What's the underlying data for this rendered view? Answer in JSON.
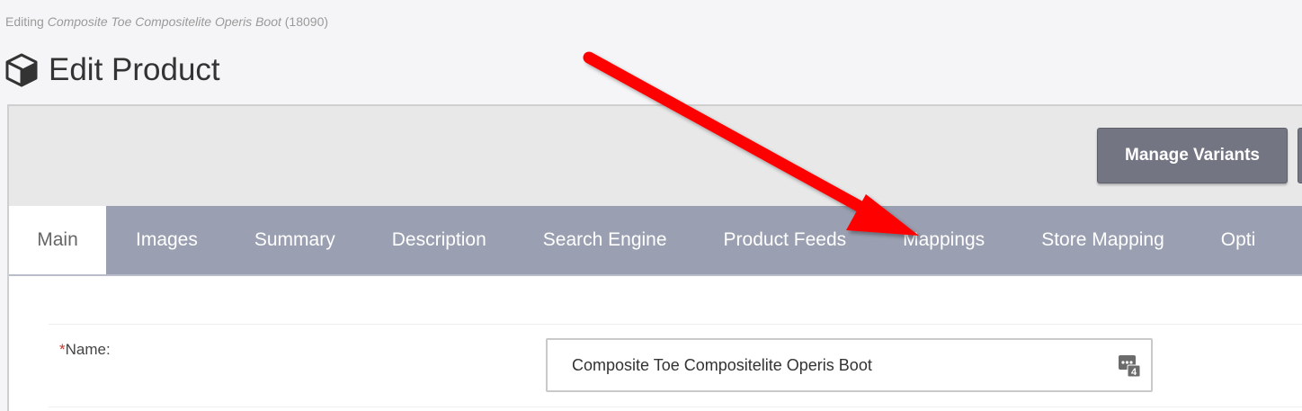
{
  "breadcrumb": {
    "prefix": "Editing",
    "product_name": "Composite Toe Compositelite Operis Boot",
    "product_id": "(18090)"
  },
  "header": {
    "title": "Edit Product",
    "icon": "cube-icon"
  },
  "toolbar": {
    "manage_variants_label": "Manage Variants"
  },
  "tabs": [
    {
      "label": "Main",
      "active": true
    },
    {
      "label": "Images"
    },
    {
      "label": "Summary"
    },
    {
      "label": "Description"
    },
    {
      "label": "Search Engine"
    },
    {
      "label": "Product Feeds"
    },
    {
      "label": "Mappings"
    },
    {
      "label": "Store Mapping"
    },
    {
      "label": "Opti"
    }
  ],
  "form": {
    "name_required_marker": "*",
    "name_label": "Name:",
    "name_value": "Composite Toe Compositelite Operis Boot",
    "locale_badge": "4"
  },
  "annotation": {
    "arrow_color": "#ff0000",
    "points_to": "Mappings"
  },
  "colors": {
    "tab_bar": "#9aa0b1",
    "button": "#737582",
    "toolbar": "#e8e8e8"
  }
}
